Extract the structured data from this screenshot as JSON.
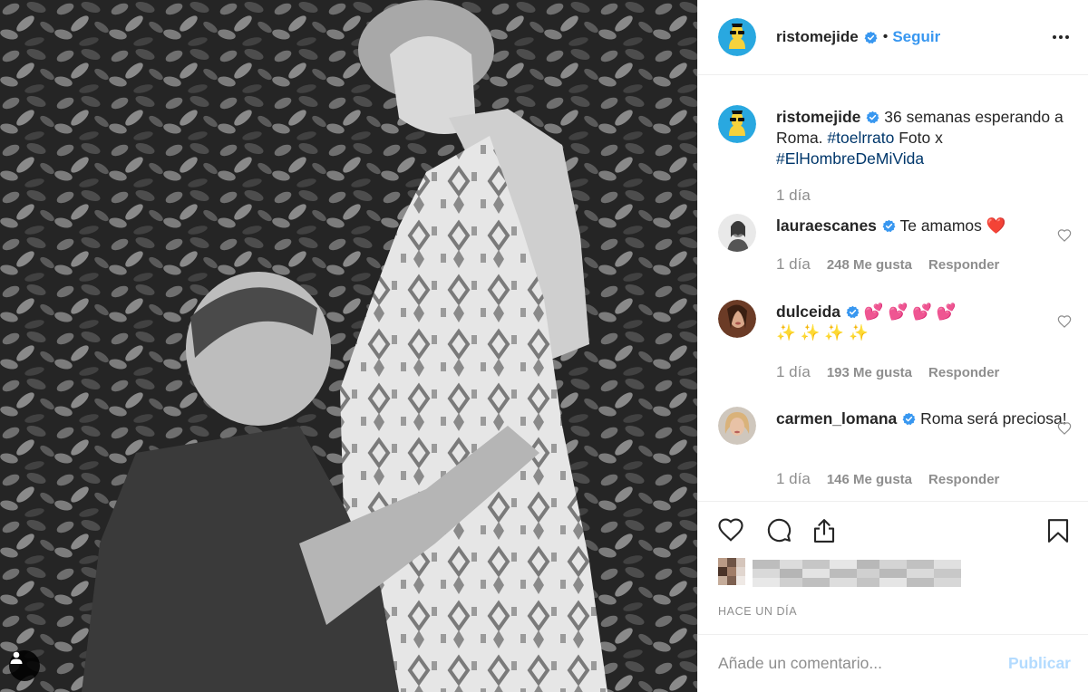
{
  "post": {
    "author": "ristomejide",
    "follow_label": "Seguir",
    "separator": "•",
    "verified": true,
    "photo_alt": "Foto en blanco y negro"
  },
  "caption": {
    "author": "ristomejide",
    "text_before": " 36 semanas esperando a Roma. ",
    "hashtag_1": "#toelrrato",
    "text_middle": " Foto x ",
    "hashtag_2": "#ElHombreDeMiVida",
    "time": "1 día"
  },
  "comments": [
    {
      "user": "lauraescanes",
      "text": " Te amamos ❤️",
      "time": "1 día",
      "likes": "248 Me gusta",
      "reply": "Responder"
    },
    {
      "user": "dulceida",
      "text": " 💕 💕 💕 💕",
      "text_line2": "✨ ✨ ✨ ✨",
      "time": "1 día",
      "likes": "193 Me gusta",
      "reply": "Responder"
    },
    {
      "user": "carmen_lomana",
      "text": " Roma será preciosa!",
      "time": "1 día",
      "likes": "146 Me gusta",
      "reply": "Responder"
    }
  ],
  "post_time": "HACE UN DÍA",
  "add_comment": {
    "placeholder": "Añade un comentario...",
    "publish_label": "Publicar"
  },
  "icons": {
    "like": "heart-icon",
    "comment": "comment-icon",
    "share": "share-icon",
    "save": "bookmark-icon",
    "more": "more-dots-icon",
    "user_tag": "user-tag-icon"
  },
  "colors": {
    "link": "#3897f0",
    "hashtag": "#00376b",
    "muted": "#8e8e8e",
    "publish_disabled": "#b3dbff",
    "verified": "#3897f0"
  }
}
